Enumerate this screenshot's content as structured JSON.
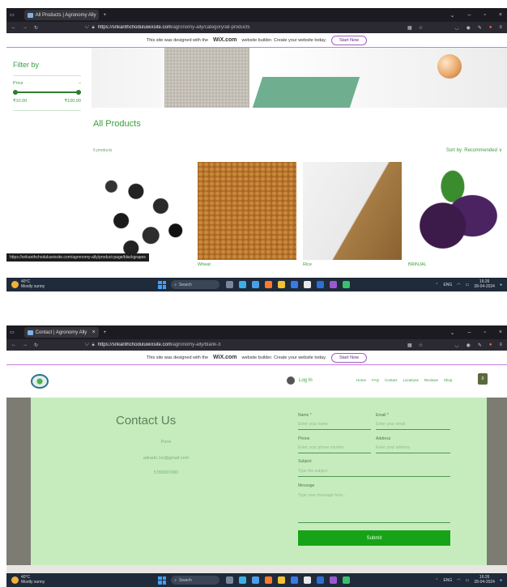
{
  "shot1": {
    "tab_title": "All Products | Agronomy Ally",
    "url_host": "https://srikanthchoduluwixsite.com",
    "url_path": "/agronomy-ally/category/all-products",
    "wix_banner": {
      "text": "This site was designed with the",
      "brand": "WiX.com",
      "text2": "website builder. Create your website today.",
      "button": "Start Now"
    },
    "filter": {
      "title": "Filter by",
      "price_label": "Price",
      "collapse": "–",
      "min": "₹10.00",
      "max": "₹100.00",
      "range_min_fraction": 0.0,
      "range_max_fraction": 1.0
    },
    "heading": "All Products",
    "count": "6 products",
    "sort": "Sort by: Recommended ∨",
    "products": [
      {
        "name": "",
        "image": "black-grapes"
      },
      {
        "name": "Wheat",
        "image": "wheat-grains"
      },
      {
        "name": "Rice",
        "image": "rice-sack"
      },
      {
        "name": "BRINJAL",
        "image": "brinjal"
      }
    ],
    "status_url": "https://srikanthchoduluwixsite.com/agronomy-ally/product-page/blackgrapes"
  },
  "shot2": {
    "tab_title": "Contact | Agronomy Ally",
    "url_host": "https://srikanthchoduluwixsite.com",
    "url_path": "/agronomy-ally/blank-3",
    "wix_banner": {
      "text": "This site was designed with the",
      "brand": "WiX.com",
      "text2": "website builder. Create your website today.",
      "button": "Start Now"
    },
    "nav": {
      "login": "Log In",
      "menu": [
        "Home",
        "FAQ",
        "Contact",
        "Locations",
        "Reviews",
        "Shop"
      ],
      "cart_count": "0"
    },
    "contact": {
      "title": "Contact Us",
      "city": "Pune",
      "email": "adradri.1w@gmail.com",
      "phone": "5789007090",
      "fields": {
        "name_label": "Name *",
        "name_placeholder": "Enter your name",
        "email_label": "Email *",
        "email_placeholder": "Enter your email",
        "phone_label": "Phone",
        "phone_placeholder": "Enter your phone number",
        "address_label": "Address",
        "address_placeholder": "Enter your address",
        "subject_label": "Subject",
        "subject_placeholder": "Type the subject",
        "message_label": "Message",
        "message_placeholder": "Type your message here..."
      },
      "submit": "Submit"
    }
  },
  "taskbar": {
    "weather_temp": "40°C",
    "weather_desc": "Mostly sunny",
    "search": "Search",
    "lang": "ENG",
    "region": "IN",
    "time": "16:26",
    "date": "28-04-2024"
  },
  "colors": {
    "brand_green": "#3b9e3e",
    "panel_green": "#c6ecbd",
    "submit_green": "#17a317",
    "chrome_dark": "#1c1b22",
    "wix_purple": "#a060c0"
  }
}
